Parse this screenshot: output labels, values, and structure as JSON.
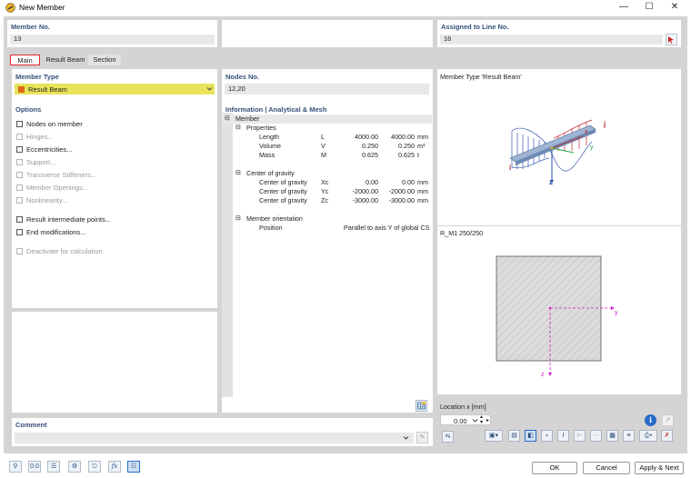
{
  "window": {
    "title": "New Member",
    "min_icon": "minimize-icon",
    "max_icon": "maximize-icon",
    "close_icon": "close-icon"
  },
  "member_no": {
    "label": "Member No.",
    "value": "13"
  },
  "assigned_line": {
    "label": "Assigned to Line No.",
    "value": "16"
  },
  "tabs": [
    {
      "label": "Main"
    },
    {
      "label": "Result Beam"
    },
    {
      "label": "Section"
    }
  ],
  "member_type": {
    "label": "Member Type",
    "value": "Result Beam",
    "color": "#e06a1a",
    "field_color": "#e8e35a"
  },
  "nodes": {
    "label": "Nodes No.",
    "value": "12,20"
  },
  "options": {
    "label": "Options",
    "items": [
      {
        "label": "Nodes on member",
        "enabled": true
      },
      {
        "label": "Hinges...",
        "enabled": false
      },
      {
        "label": "Eccentricities...",
        "enabled": true
      },
      {
        "label": "Support...",
        "enabled": false
      },
      {
        "label": "Transverse Stiffeners...",
        "enabled": false
      },
      {
        "label": "Member Openings...",
        "enabled": false
      },
      {
        "label": "Nonlinearity...",
        "enabled": false
      },
      {
        "label": "Result intermediate points...",
        "enabled": true
      },
      {
        "label": "End modifications...",
        "enabled": true
      },
      {
        "label": "Deactivate for calculation",
        "enabled": false
      }
    ]
  },
  "info": {
    "label": "Information | Analytical & Mesh",
    "root": "Member",
    "properties": {
      "label": "Properties",
      "rows": [
        {
          "name": "Length",
          "sym": "L",
          "v1": "4000.00",
          "v2": "4000.00",
          "unit": "mm"
        },
        {
          "name": "Volume",
          "sym": "V",
          "v1": "0.250",
          "v2": "0.250",
          "unit": "m³"
        },
        {
          "name": "Mass",
          "sym": "M",
          "v1": "0.625",
          "v2": "0.625",
          "unit": "t"
        }
      ]
    },
    "cog": {
      "label": "Center of gravity",
      "rows": [
        {
          "name": "Center of gravity",
          "sym": "Xc",
          "v1": "0.00",
          "v2": "0.00",
          "unit": "mm"
        },
        {
          "name": "Center of gravity",
          "sym": "Yc",
          "v1": "-2000.00",
          "v2": "-2000.00",
          "unit": "mm"
        },
        {
          "name": "Center of gravity",
          "sym": "Zc",
          "v1": "-3000.00",
          "v2": "-3000.00",
          "unit": "mm"
        }
      ]
    },
    "orientation": {
      "label": "Member orientation",
      "rows": [
        {
          "name": "Position",
          "value": "Parallel to axis Y of global CS"
        }
      ]
    }
  },
  "preview": {
    "title": "Member Type 'Result Beam'",
    "axis_i": "i",
    "axis_j": "j",
    "axis_x": "x",
    "axis_y": "y",
    "axis_z": "z"
  },
  "section": {
    "name": "R_M1 250/250",
    "axis_y": "y",
    "axis_z": "z"
  },
  "location": {
    "label": "Location x [mm]",
    "value": "0.00"
  },
  "comment": {
    "label": "Comment",
    "value": ""
  },
  "buttons": {
    "ok": "OK",
    "cancel": "Cancel",
    "apply_next": "Apply & Next"
  }
}
